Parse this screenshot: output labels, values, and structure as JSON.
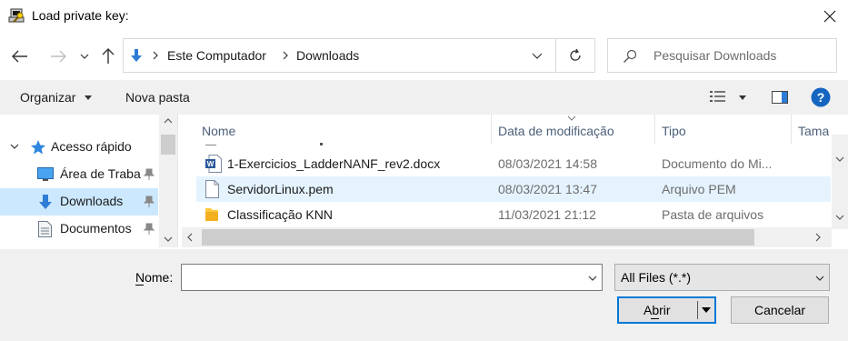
{
  "window": {
    "title": "Load private key:"
  },
  "navigation": {
    "path": [
      "Este Computador",
      "Downloads"
    ],
    "search_placeholder": "Pesquisar Downloads"
  },
  "toolbar": {
    "organize_label": "Organizar",
    "new_folder_label": "Nova pasta"
  },
  "sidebar": {
    "items": [
      {
        "label": "Acesso rápido",
        "icon": "star-icon"
      },
      {
        "label": "Área de Traba",
        "icon": "desktop-icon"
      },
      {
        "label": "Downloads",
        "icon": "download-arrow-icon",
        "selected": true
      },
      {
        "label": "Documentos",
        "icon": "document-icon"
      }
    ]
  },
  "file_list": {
    "columns": [
      "Nome",
      "Data de modificação",
      "Tipo",
      "Tama"
    ],
    "rows": [
      {
        "name": "1-Exercicios_LadderNANF_rev2.docx",
        "date": "08/03/2021 14:58",
        "type": "Documento do Mi...",
        "icon": "word-document-icon"
      },
      {
        "name": "ServidorLinux.pem",
        "date": "08/03/2021 13:47",
        "type": "Arquivo PEM",
        "icon": "blank-file-icon",
        "hovered": true
      },
      {
        "name": "Classificação KNN",
        "date": "11/03/2021 21:12",
        "type": "Pasta de arquivos",
        "icon": "folder-icon"
      }
    ]
  },
  "footer": {
    "name_label": "Nome:",
    "name_value": "",
    "filetype_value": "All Files (*.*)",
    "open_label": "Abrir",
    "cancel_label": "Cancelar"
  },
  "colors": {
    "accent": "#0078d7",
    "selection": "#cce8ff",
    "hover": "#e5f3ff",
    "folder": "#ffc83d",
    "word_blue": "#2b579a"
  }
}
